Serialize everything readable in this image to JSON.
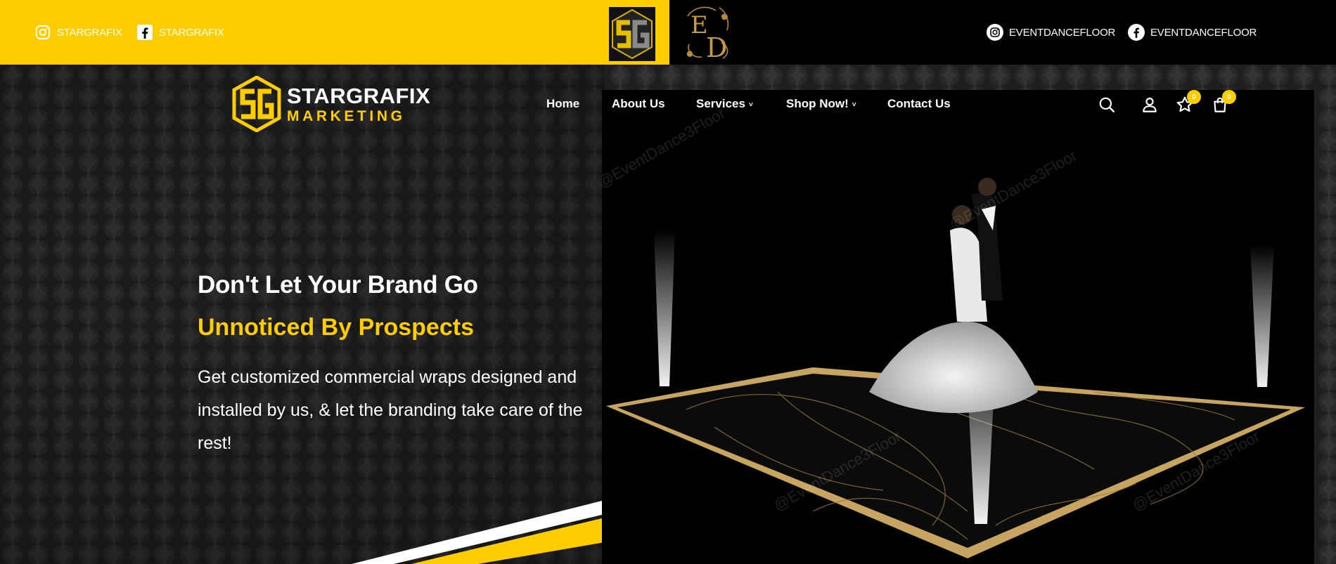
{
  "topbar": {
    "left_links": [
      {
        "label": "STARGRAFIX",
        "icon": "instagram-icon"
      },
      {
        "label": "STARGRAFIX",
        "icon": "facebook-icon"
      }
    ],
    "right_links": [
      {
        "label": "EVENTDANCEFLOOR",
        "icon": "instagram-icon"
      },
      {
        "label": "EVENTDANCEFLOOR",
        "icon": "facebook-icon"
      }
    ],
    "mini_logo_left": "SG",
    "mini_logo_right": "ED"
  },
  "brand": {
    "name": "STARGRAFIX",
    "tagline": "MARKETING",
    "mark": "SG",
    "accent_color": "#fecd00"
  },
  "nav": {
    "items": [
      {
        "label": "Home",
        "dropdown": false
      },
      {
        "label": "About Us",
        "dropdown": false
      },
      {
        "label": "Services",
        "dropdown": true
      },
      {
        "label": "Shop Now!",
        "dropdown": true
      },
      {
        "label": "Contact Us",
        "dropdown": false
      }
    ],
    "tools": {
      "search": "search-icon",
      "account": "user-icon",
      "wishlist": "star-icon",
      "wishlist_count": "0",
      "cart": "shopping-bag-icon",
      "cart_count": "0"
    }
  },
  "hero": {
    "headline_line1": "Don't Let Your Brand Go",
    "headline_line2": "Unnoticed By Prospects",
    "description": "Get customized commercial wraps designed and installed by us, & let the branding take care of the rest!",
    "image_alt": "Bride and groom dancing on a black and gold dance floor with cold spark fountains",
    "watermark": "@EventDance3Floor"
  }
}
